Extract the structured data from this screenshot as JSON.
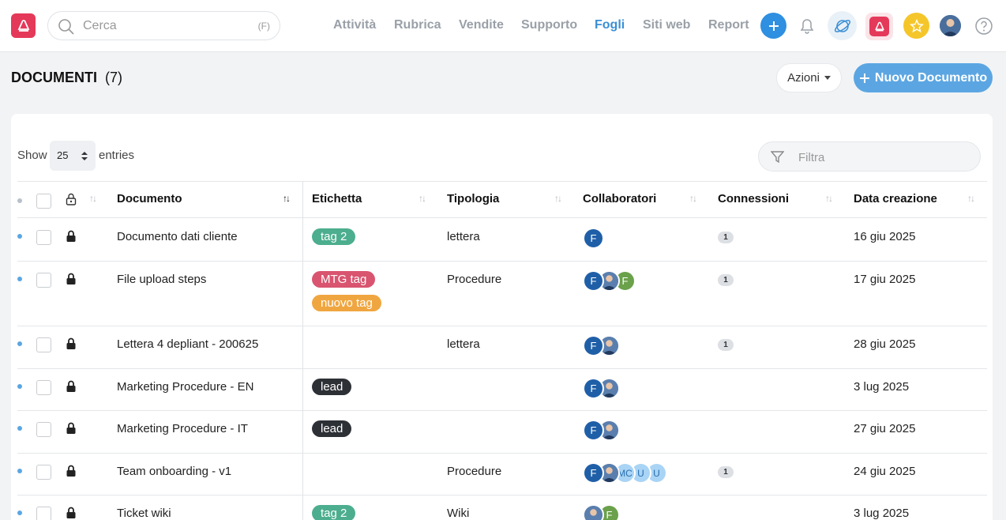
{
  "topbar": {
    "search_placeholder": "Cerca",
    "search_shortcut": "(F)",
    "nav": [
      "Attività",
      "Rubrica",
      "Vendite",
      "Supporto",
      "Fogli",
      "Siti web",
      "Report"
    ],
    "active_nav": "Fogli"
  },
  "header": {
    "title": "DOCUMENTI",
    "count": "(7)",
    "actions_label": "Azioni",
    "new_label": "Nuovo Documento"
  },
  "table_controls": {
    "show_label": "Show",
    "entries_value": "25",
    "entries_label": "entries",
    "filter_placeholder": "Filtra"
  },
  "columns": [
    "Documento",
    "Etichetta",
    "Tipologia",
    "Collaboratori",
    "Connessioni",
    "Data creazione"
  ],
  "rows": [
    {
      "name": "Documento dati cliente",
      "tags": [
        {
          "label": "tag 2",
          "color": "#4cae8e"
        }
      ],
      "type": "lettera",
      "collab": [
        "F"
      ],
      "conn": "1",
      "date": "16 giu 2025"
    },
    {
      "name": "File upload steps",
      "tags": [
        {
          "label": "MTG tag",
          "color": "#d9546f"
        },
        {
          "label": "nuovo tag",
          "color": "#f0a640"
        }
      ],
      "type": "Procedure",
      "collab": [
        "F",
        "photo",
        "F-green"
      ],
      "conn": "1",
      "date": "17 giu 2025"
    },
    {
      "name": "Lettera 4 depliant - 200625",
      "tags": [],
      "type": "lettera",
      "collab": [
        "F",
        "photo"
      ],
      "conn": "1",
      "date": "28 giu 2025"
    },
    {
      "name": "Marketing Procedure - EN",
      "tags": [
        {
          "label": "lead",
          "color": "#2d3035"
        }
      ],
      "type": "",
      "collab": [
        "F",
        "photo"
      ],
      "conn": "",
      "date": "3 lug 2025"
    },
    {
      "name": "Marketing Procedure - IT",
      "tags": [
        {
          "label": "lead",
          "color": "#2d3035"
        }
      ],
      "type": "",
      "collab": [
        "F",
        "photo"
      ],
      "conn": "",
      "date": "27 giu 2025"
    },
    {
      "name": "Team onboarding - v1",
      "tags": [],
      "type": "Procedure",
      "collab": [
        "F",
        "photo",
        "MC",
        "U",
        "U"
      ],
      "conn": "1",
      "date": "24 giu 2025"
    },
    {
      "name": "Ticket wiki",
      "tags": [
        {
          "label": "tag 2",
          "color": "#4cae8e"
        }
      ],
      "type": "Wiki",
      "collab": [
        "photo",
        "F-green"
      ],
      "conn": "",
      "date": "3 lug 2025"
    }
  ],
  "colors": {
    "accent": "#3a8fd6",
    "brand": "#e5395a",
    "primary_button": "#5ba6e2"
  }
}
